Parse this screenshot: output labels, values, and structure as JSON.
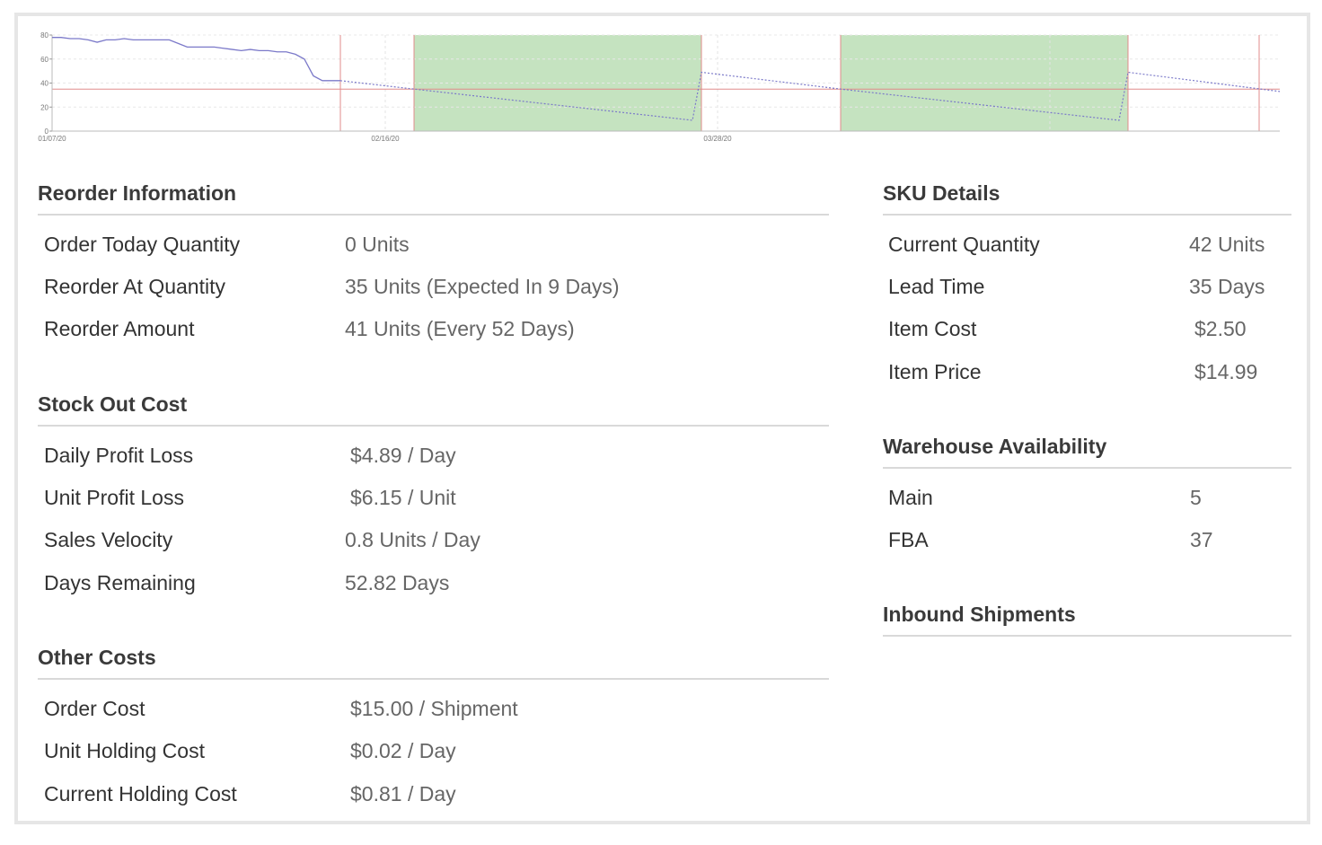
{
  "chart_data": {
    "type": "line",
    "x_tick_labels": [
      "01/07/20",
      "02/16/20",
      "03/28/20"
    ],
    "y_tick_labels": [
      "0",
      "20",
      "40",
      "60",
      "80"
    ],
    "ylim": [
      0,
      80
    ],
    "reorder_at_quantity": 35,
    "series": [
      {
        "style": "solid",
        "color": "#7b79c9",
        "values": [
          78,
          78,
          77,
          77,
          76,
          74,
          76,
          76,
          77,
          76,
          76,
          76,
          76,
          76,
          73,
          70,
          70,
          70,
          70,
          69,
          68,
          67,
          68,
          67,
          67,
          66,
          66,
          64,
          60,
          46,
          42,
          42,
          42
        ]
      }
    ],
    "forecast_color": "#7b79c9",
    "order_window_color": "#c5e3c0",
    "reorder_line_color": "#e08b8b"
  },
  "reorder": {
    "title": "Reorder Information",
    "rows": [
      {
        "label": "Order Today Quantity",
        "value": "0 Units"
      },
      {
        "label": "Reorder At Quantity",
        "value": "35 Units (Expected In 9 Days)"
      },
      {
        "label": "Reorder Amount",
        "value": "41 Units (Every 52 Days)"
      }
    ]
  },
  "stockout": {
    "title": "Stock Out Cost",
    "rows": [
      {
        "label": "Daily Profit Loss",
        "value": "$4.89 / Day"
      },
      {
        "label": "Unit Profit Loss",
        "value": "$6.15 / Unit"
      },
      {
        "label": "Sales Velocity",
        "value": "0.8 Units / Day"
      },
      {
        "label": "Days Remaining",
        "value": "52.82 Days"
      }
    ]
  },
  "other": {
    "title": "Other Costs",
    "rows": [
      {
        "label": "Order Cost",
        "value": "$15.00 / Shipment"
      },
      {
        "label": "Unit Holding Cost",
        "value": "$0.02 / Day"
      },
      {
        "label": "Current Holding Cost",
        "value": "$0.81 / Day"
      }
    ]
  },
  "sku": {
    "title": "SKU Details",
    "rows": [
      {
        "label": "Current Quantity",
        "value": "42 Units"
      },
      {
        "label": "Lead Time",
        "value": "35 Days"
      },
      {
        "label": "Item Cost",
        "value": "$2.50"
      },
      {
        "label": "Item Price",
        "value": "$14.99"
      }
    ]
  },
  "warehouse": {
    "title": "Warehouse Availability",
    "rows": [
      {
        "label": "Main",
        "value": "5"
      },
      {
        "label": "FBA",
        "value": "37"
      }
    ]
  },
  "inbound": {
    "title": "Inbound Shipments"
  }
}
